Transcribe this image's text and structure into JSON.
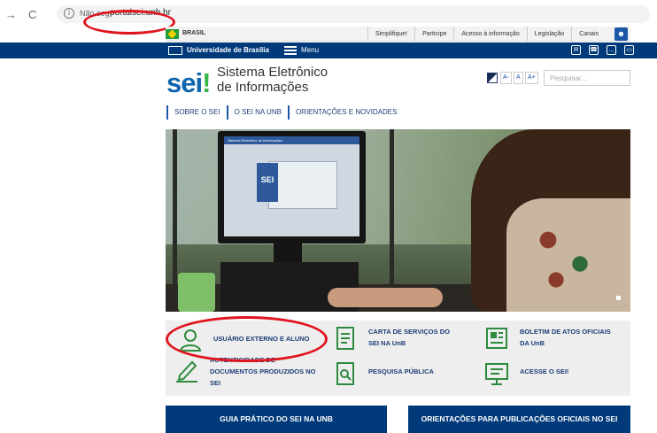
{
  "browser": {
    "back": "→",
    "reload": "C",
    "not_secure": "Não seg",
    "url": "portalsei.unb.br"
  },
  "gov_bar": {
    "brasil": "BRASIL",
    "links": [
      "Simplifique!",
      "Participe",
      "Acesso à informação",
      "Legislação",
      "Canais"
    ]
  },
  "blue_bar": {
    "university": "Universidade de Brasília",
    "menu": "Menu"
  },
  "header": {
    "logo_text": "sei",
    "logo_bang": "!",
    "title": "Sistema Eletrônico de Informações",
    "font_buttons": [
      "A-",
      "A",
      "A+"
    ],
    "search_placeholder": "Pesquisar..."
  },
  "nav": [
    "SOBRE O SEI",
    "O SEI NA UNB",
    "ORIENTAÇÕES E NOVIDADES"
  ],
  "hero": {
    "screen_header": "Sistema Eletrônico de Informações",
    "screen_logo": "SEI"
  },
  "services": [
    {
      "label": "USUÁRIO EXTERNO E ALUNO",
      "icon": "user-icon"
    },
    {
      "label": "CARTA DE SERVIÇOS DO SEI NA UnB",
      "icon": "document-icon"
    },
    {
      "label": "BOLETIM DE ATOS OFICIAIS DA UnB",
      "icon": "newspaper-icon"
    },
    {
      "label": "AUTENTICIDADE DE DOCUMENTOS PRODUZIDOS NO SEI",
      "icon": "pen-signature-icon"
    },
    {
      "label": "PESQUISA PÚBLICA",
      "icon": "search-document-icon"
    },
    {
      "label": "ACESSE O SEI!",
      "icon": "monitor-icon"
    }
  ],
  "buttons": {
    "guia": "GUIA PRÁTICO DO SEI NA UNB",
    "orientacoes": "ORIENTAÇÕES PARA PUBLICAÇÕES OFICIAIS NO SEI"
  },
  "colors": {
    "brand_blue": "#003a7a",
    "sei_blue": "#0e64ad",
    "sei_green": "#38b549",
    "icon_green": "#2e8b3d",
    "highlight_red": "#e0141e"
  }
}
